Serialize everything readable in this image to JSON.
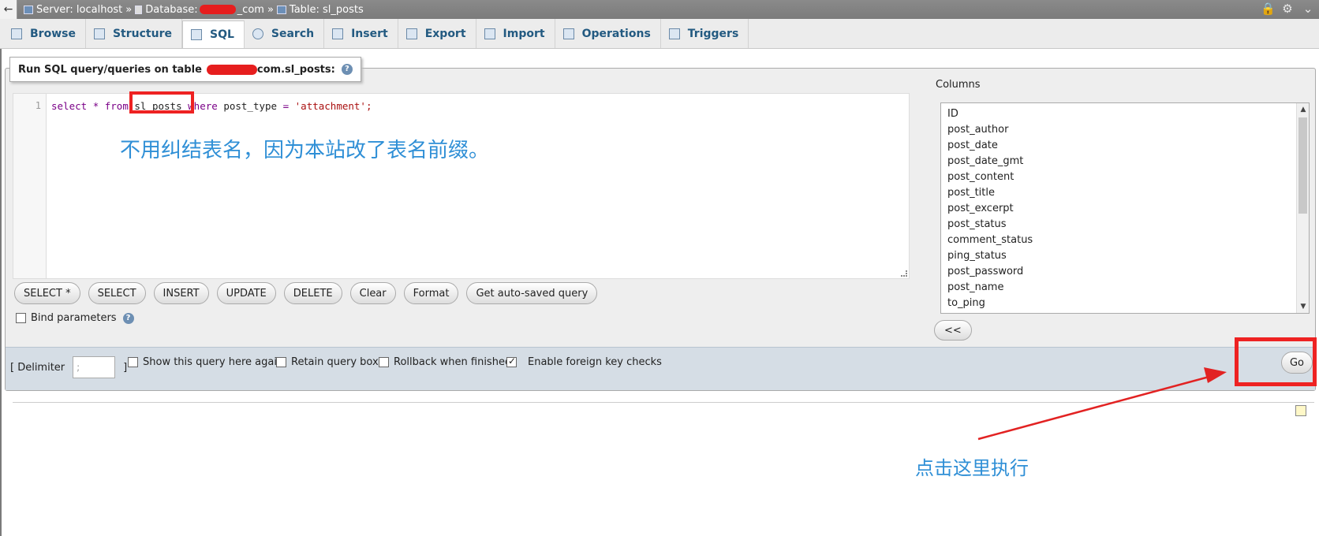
{
  "breadcrumb": {
    "server": "Server: localhost",
    "separator": "»",
    "database_prefix": "Database:",
    "database_suffix": "_com",
    "table": "Table: sl_posts"
  },
  "tabs": [
    {
      "label": "Browse",
      "icon": "browse-icon"
    },
    {
      "label": "Structure",
      "icon": "structure-icon"
    },
    {
      "label": "SQL",
      "icon": "sql-icon",
      "active": true
    },
    {
      "label": "Search",
      "icon": "search-icon"
    },
    {
      "label": "Insert",
      "icon": "insert-icon"
    },
    {
      "label": "Export",
      "icon": "export-icon"
    },
    {
      "label": "Import",
      "icon": "import-icon"
    },
    {
      "label": "Operations",
      "icon": "operations-icon"
    },
    {
      "label": "Triggers",
      "icon": "triggers-icon"
    }
  ],
  "legend": {
    "prefix": "Run SQL query/queries on table",
    "suffix": "com.sl_posts:"
  },
  "editor": {
    "line_number": "1",
    "kw_select": "select",
    "star": "*",
    "kw_from": "from",
    "table": "sl_posts",
    "kw_where": "where",
    "field": "post_type",
    "eq": "=",
    "value": "'attachment';"
  },
  "annotations": {
    "table_note": "不用纠结表名，因为本站改了表名前缀。",
    "go_note": "点击这里执行"
  },
  "buttons": [
    "SELECT *",
    "SELECT",
    "INSERT",
    "UPDATE",
    "DELETE",
    "Clear",
    "Format",
    "Get auto-saved query"
  ],
  "bind_parameters": "Bind parameters",
  "columns": {
    "label": "Columns",
    "items": [
      "ID",
      "post_author",
      "post_date",
      "post_date_gmt",
      "post_content",
      "post_title",
      "post_excerpt",
      "post_status",
      "comment_status",
      "ping_status",
      "post_password",
      "post_name",
      "to_ping"
    ],
    "insert_button": "<<"
  },
  "options": {
    "delimiter_label": "[ Delimiter",
    "delimiter_close": "]",
    "delimiter_value": ";",
    "show_query": "Show this query here again",
    "retain_box": "Retain query box",
    "rollback": "Rollback when finished",
    "foreign_keys": "Enable foreign key checks",
    "foreign_keys_checked": true
  },
  "go_button": "Go",
  "colors": {
    "annotation_red": "#e22222",
    "annotation_blue": "#2f8fd6",
    "tab_text": "#235a81"
  }
}
